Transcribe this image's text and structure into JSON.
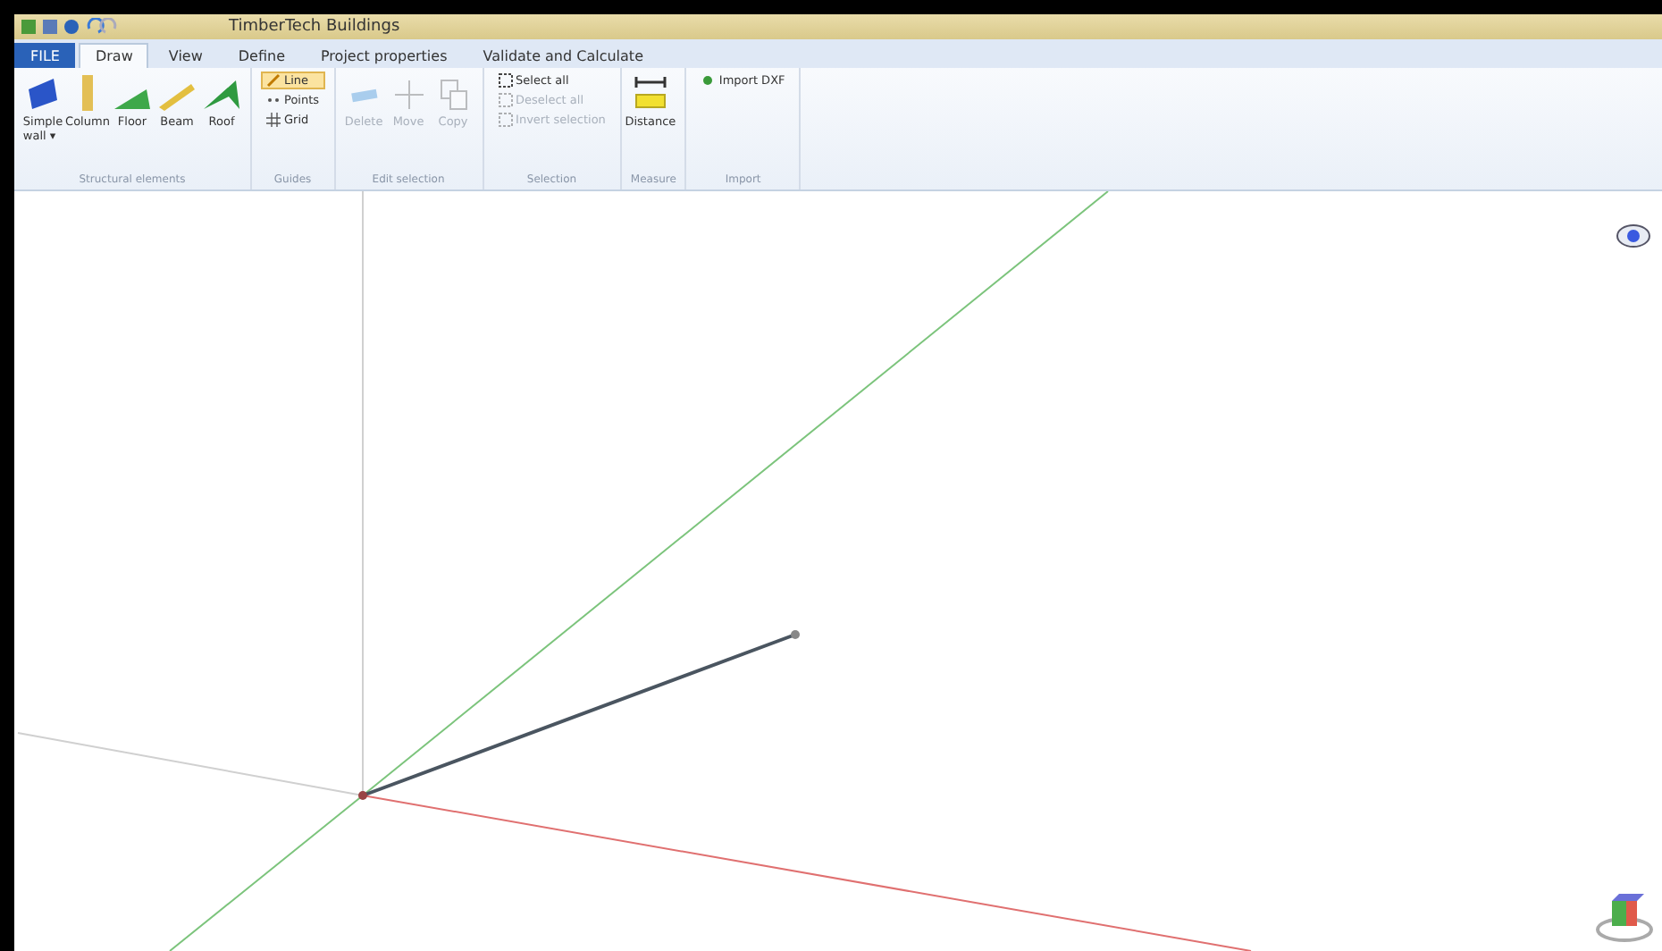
{
  "window": {
    "title": "TimberTech Buildings"
  },
  "tabs": [
    {
      "label": "FILE",
      "kind": "file",
      "selected": false
    },
    {
      "label": "Draw",
      "kind": "tab",
      "selected": true
    },
    {
      "label": "View",
      "kind": "tab",
      "selected": false
    },
    {
      "label": "Define",
      "kind": "tab",
      "selected": false
    },
    {
      "label": "Project properties",
      "kind": "tab",
      "selected": false
    },
    {
      "label": "Validate and Calculate",
      "kind": "tab",
      "selected": false
    }
  ],
  "ribbon_groups": [
    {
      "label": "Structural elements",
      "items": [
        {
          "label": "Simple wall ▾",
          "kind": "large",
          "disabled": false
        },
        {
          "label": "Column",
          "kind": "large",
          "disabled": false
        },
        {
          "label": "Floor",
          "kind": "large",
          "disabled": false
        },
        {
          "label": "Beam",
          "kind": "large",
          "disabled": false
        },
        {
          "label": "Roof",
          "kind": "large",
          "disabled": false
        }
      ]
    },
    {
      "label": "Guides",
      "items": [
        {
          "label": "Line",
          "kind": "toggle",
          "disabled": false,
          "selected": true
        },
        {
          "label": "Points",
          "kind": "toggle",
          "disabled": false,
          "selected": false
        },
        {
          "label": "Grid",
          "kind": "toggle",
          "disabled": false,
          "selected": false
        }
      ]
    },
    {
      "label": "Edit selection",
      "items": [
        {
          "label": "Delete",
          "kind": "large",
          "disabled": true
        },
        {
          "label": "Move",
          "kind": "large",
          "disabled": true
        },
        {
          "label": "Copy",
          "kind": "large",
          "disabled": true
        }
      ]
    },
    {
      "label": "Selection",
      "items": [
        {
          "label": "Select all",
          "kind": "small",
          "disabled": false
        },
        {
          "label": "Deselect all",
          "kind": "small",
          "disabled": true
        },
        {
          "label": "Invert selection",
          "kind": "small",
          "disabled": true
        }
      ]
    },
    {
      "label": "Measure",
      "items": [
        {
          "label": "Distance",
          "kind": "large",
          "disabled": false
        }
      ]
    },
    {
      "label": "Import",
      "items": [
        {
          "label": "Import DXF",
          "kind": "small",
          "disabled": false
        }
      ]
    }
  ]
}
